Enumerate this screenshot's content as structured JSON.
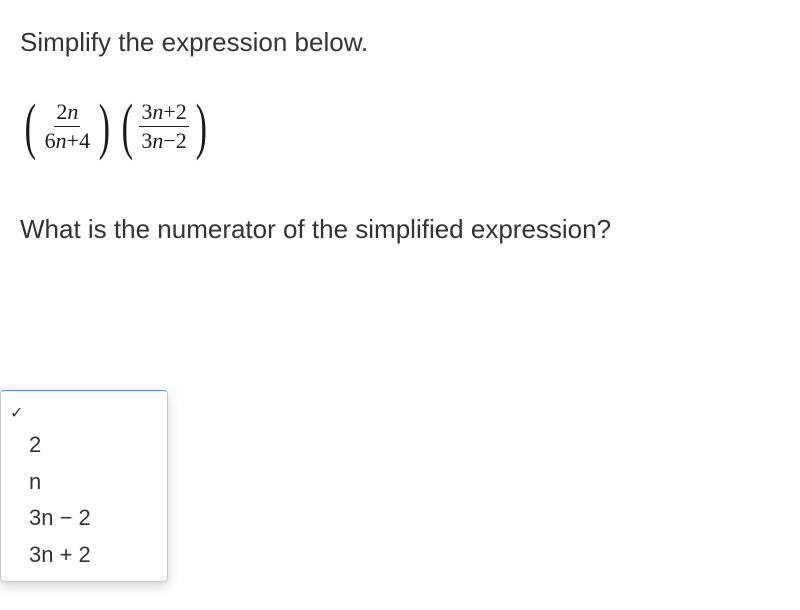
{
  "prompt": "Simplify the expression below.",
  "expression": {
    "frac1": {
      "num": "2n",
      "den": "6n+4"
    },
    "frac2": {
      "num": "3n+2",
      "den": "3n−2"
    }
  },
  "question": "What is the numerator of the simplified expression?",
  "dropdown": {
    "options": [
      {
        "label": "",
        "selected": true
      },
      {
        "label": "2",
        "selected": false
      },
      {
        "label": "n",
        "selected": false
      },
      {
        "label": "3n − 2",
        "selected": false
      },
      {
        "label": "3n + 2",
        "selected": false
      }
    ]
  }
}
